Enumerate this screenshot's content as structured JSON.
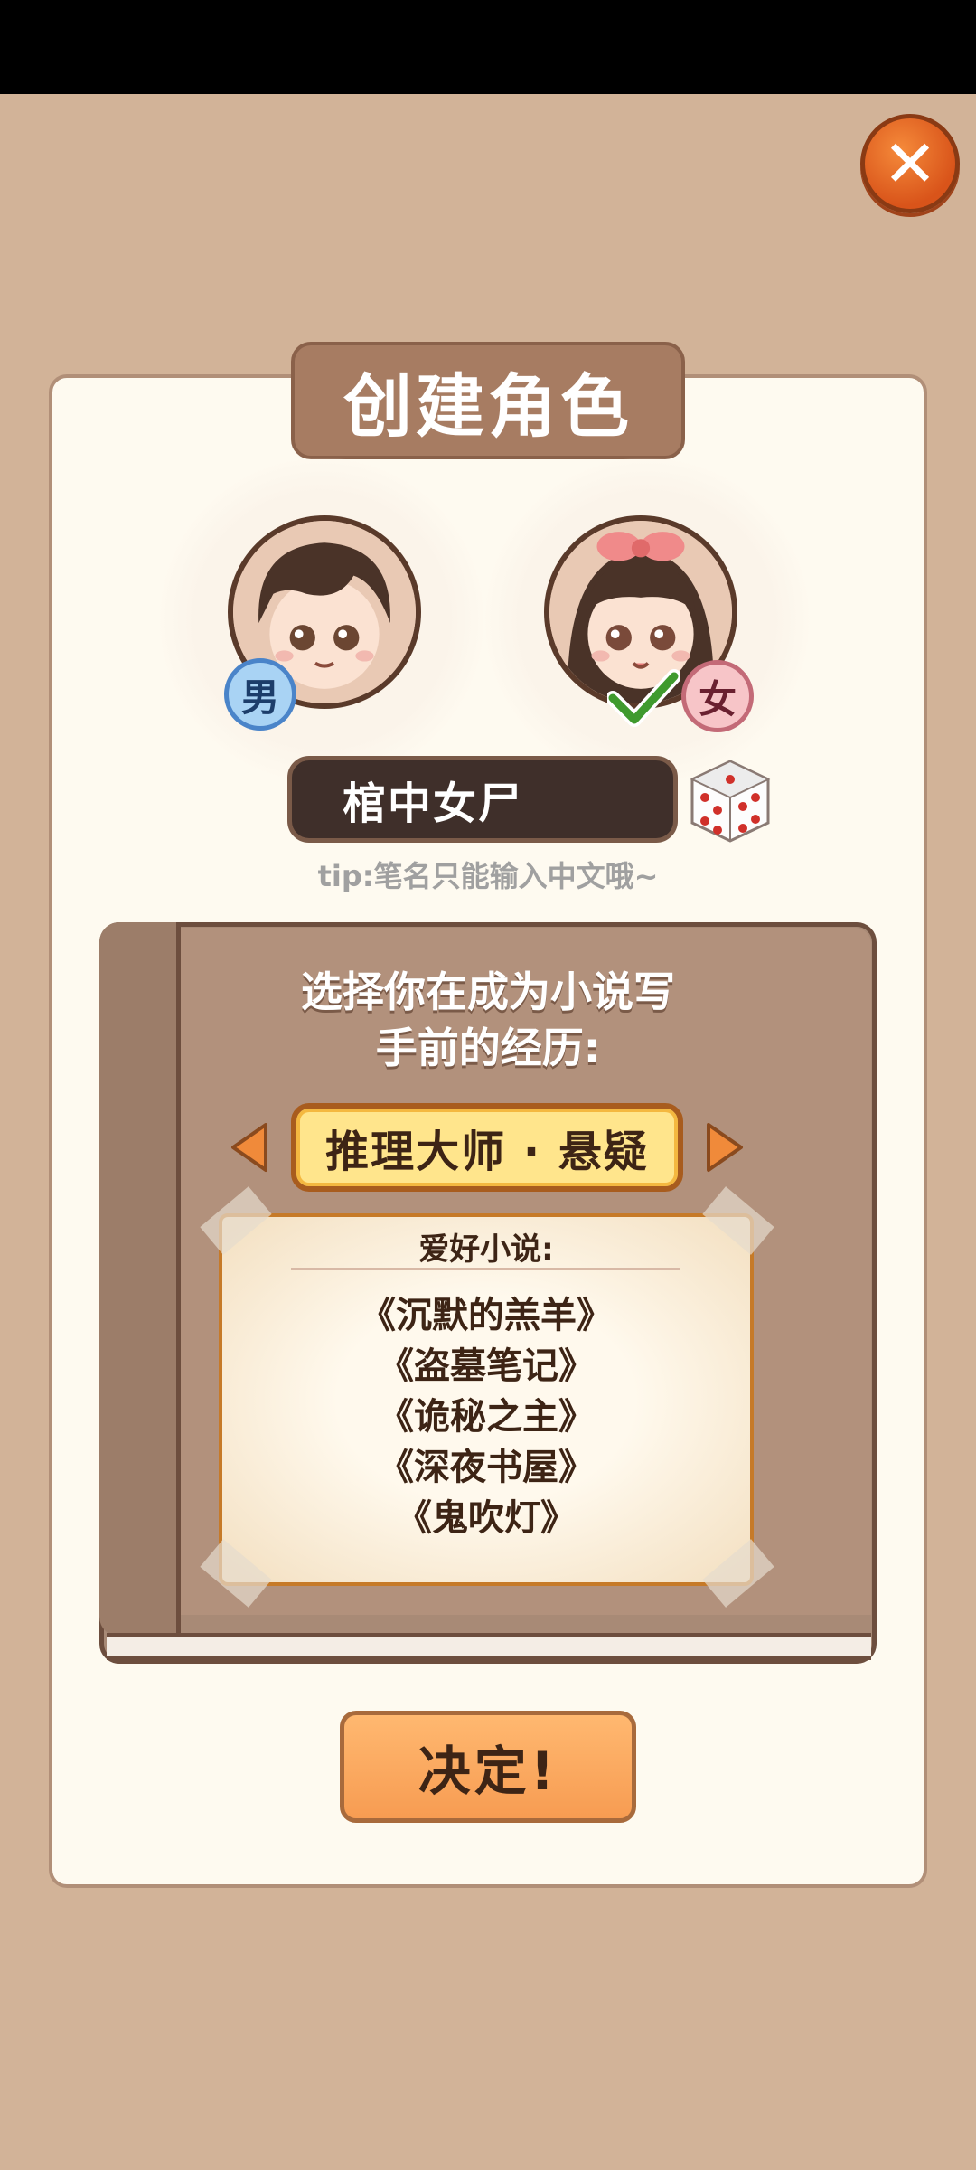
{
  "header": {
    "title": "创建角色"
  },
  "avatars": {
    "male": {
      "badge": "男",
      "selected": false
    },
    "female": {
      "badge": "女",
      "selected": true
    }
  },
  "name_field": {
    "value": "棺中女尸"
  },
  "tip": "tip:笔名只能输入中文哦~",
  "experience": {
    "prompt_line1": "选择你在成为小说写",
    "prompt_line2": "手前的经历:",
    "selected": "推理大师 · 悬疑",
    "card_title": "爱好小说:",
    "novels": [
      "《沉默的羔羊》",
      "《盗墓笔记》",
      "《诡秘之主》",
      "《深夜书屋》",
      "《鬼吹灯》"
    ]
  },
  "confirm_label": "决定!",
  "icons": {
    "close": "close-icon",
    "dice": "dice-icon",
    "prev": "arrow-left-icon",
    "next": "arrow-right-icon",
    "check": "check-icon"
  },
  "colors": {
    "background": "#d2b398",
    "panel": "#fefaf0",
    "accent_orange": "#f79c52",
    "title_plate": "#a77c62"
  }
}
